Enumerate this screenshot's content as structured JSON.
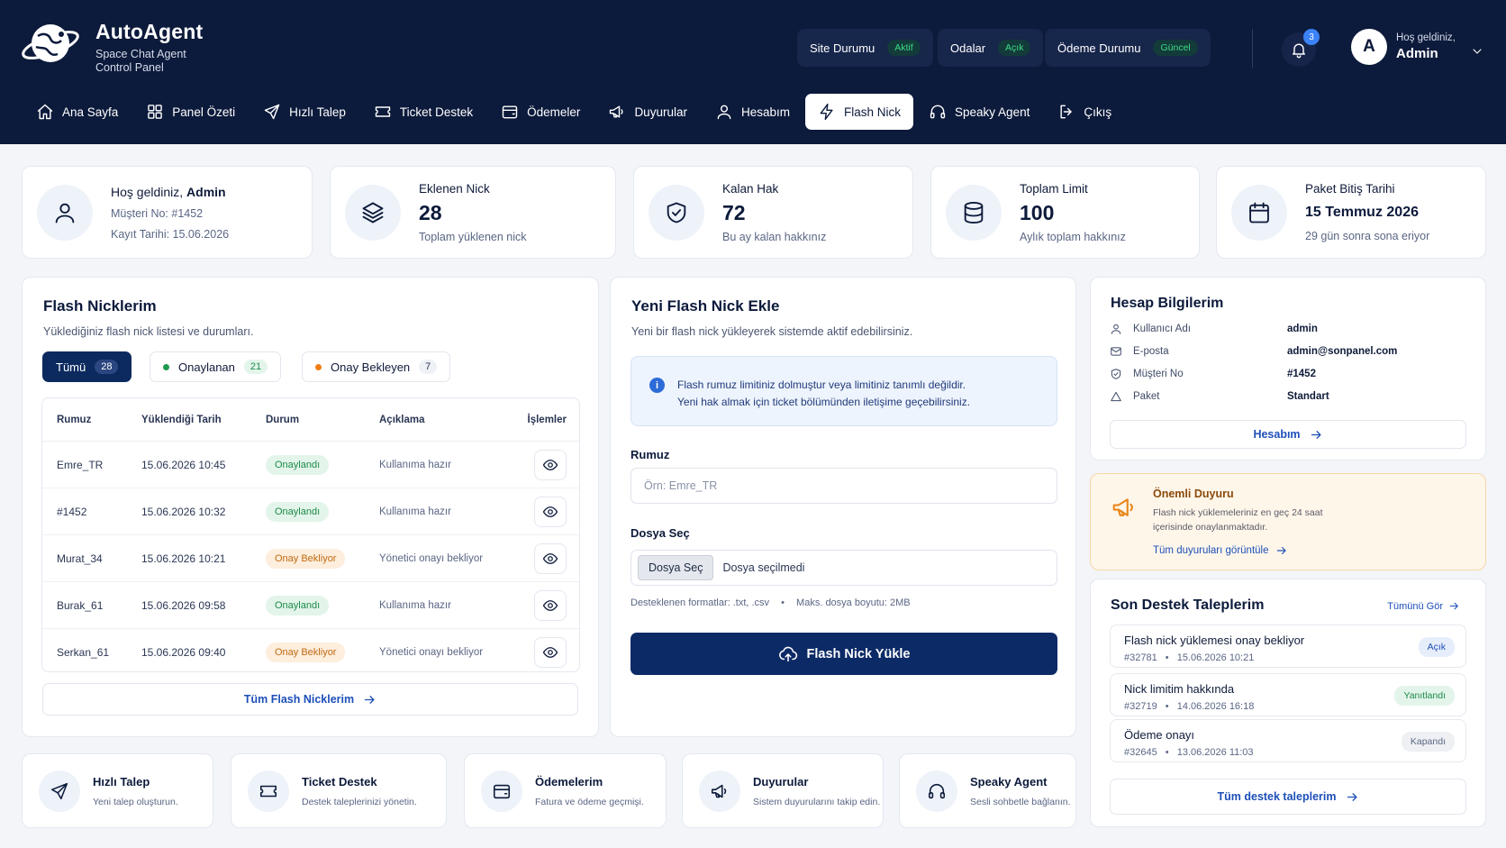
{
  "brand": {
    "name": "AutoAgent",
    "sub1": "Space Chat Agent",
    "sub2": "Control Panel"
  },
  "status": [
    {
      "label": "Site Durumu",
      "value": "Aktif"
    },
    {
      "label": "Odalar",
      "value": "Açık"
    },
    {
      "label": "Ödeme Durumu",
      "value": "Güncel"
    }
  ],
  "notifications": {
    "count": "3"
  },
  "user": {
    "initial": "A",
    "greeting": "Hoş geldiniz,",
    "name": "Admin"
  },
  "nav": [
    {
      "label": "Ana Sayfa",
      "icon": "home-icon"
    },
    {
      "label": "Panel Özeti",
      "icon": "grid-icon"
    },
    {
      "label": "Hızlı Talep",
      "icon": "send-icon"
    },
    {
      "label": "Ticket Destek",
      "icon": "ticket-icon"
    },
    {
      "label": "Ödemeler",
      "icon": "wallet-icon"
    },
    {
      "label": "Duyurular",
      "icon": "megaphone-icon"
    },
    {
      "label": "Hesabım",
      "icon": "user-icon"
    },
    {
      "label": "Flash Nick",
      "icon": "bolt-icon",
      "active": true
    },
    {
      "label": "Speaky Agent",
      "icon": "headphones-icon"
    },
    {
      "label": "Çıkış",
      "icon": "logout-icon"
    }
  ],
  "stats": {
    "welcome": {
      "prefix": "Hoş geldiniz,",
      "name": "Admin",
      "customer": "Müşteri No: #1452",
      "registered": "Kayıt Tarihi: 15.06.2026"
    },
    "added": {
      "label": "Eklenen Nick",
      "value": "28",
      "sub": "Toplam yüklenen nick"
    },
    "remaining": {
      "label": "Kalan Hak",
      "value": "72",
      "sub": "Bu ay kalan hakkınız"
    },
    "limit": {
      "label": "Toplam Limit",
      "value": "100",
      "sub": "Aylık toplam hakkınız"
    },
    "package": {
      "label": "Paket Bitiş Tarihi",
      "value": "15 Temmuz 2026",
      "sub": "29 gün sonra sona eriyor"
    }
  },
  "flash_list": {
    "title": "Flash Nicklerim",
    "subtitle": "Yüklediğiniz flash nick listesi ve durumları.",
    "tabs": [
      {
        "label": "Tümü",
        "count": "28"
      },
      {
        "label": "Onaylanan",
        "count": "21"
      },
      {
        "label": "Onay Bekleyen",
        "count": "7"
      }
    ],
    "columns": [
      "Rumuz",
      "Yüklendiği Tarih",
      "Durum",
      "Açıklama",
      "İşlemler"
    ],
    "rows": [
      {
        "nick": "Emre_TR",
        "date": "15.06.2026 10:45",
        "status": "Onaylandı",
        "note": "Kullanıma hazır"
      },
      {
        "nick": "#1452",
        "date": "15.06.2026 10:32",
        "status": "Onaylandı",
        "note": "Kullanıma hazır"
      },
      {
        "nick": "Murat_34",
        "date": "15.06.2026 10:21",
        "status": "Onay Bekliyor",
        "note": "Yönetici onayı bekliyor"
      },
      {
        "nick": "Burak_61",
        "date": "15.06.2026 09:58",
        "status": "Onaylandı",
        "note": "Kullanıma hazır"
      },
      {
        "nick": "Serkan_61",
        "date": "15.06.2026 09:40",
        "status": "Onay Bekliyor",
        "note": "Yönetici onayı bekliyor"
      }
    ],
    "all_link": "Tüm Flash Nicklerim"
  },
  "new_flash": {
    "title": "Yeni Flash Nick Ekle",
    "subtitle": "Yeni bir flash nick yükleyerek sistemde aktif edebilirsiniz.",
    "info_line1": "Flash rumuz limitiniz dolmuştur veya limitiniz tanımlı değildir.",
    "info_line2": "Yeni hak almak için ticket bölümünden iletişime geçebilirsiniz.",
    "nick_label": "Rumuz",
    "nick_placeholder": "Örn: Emre_TR",
    "file_label": "Dosya Seç",
    "file_button": "Dosya Seç",
    "file_none": "Dosya seçilmedi",
    "hint_formats": "Desteklenen formatlar: .txt, .csv",
    "hint_size": "Maks. dosya boyutu: 2MB",
    "submit": "Flash Nick Yükle"
  },
  "account": {
    "title": "Hesap Bilgilerim",
    "rows": [
      {
        "key": "Kullanıcı Adı",
        "value": "admin"
      },
      {
        "key": "E-posta",
        "value": "admin@sonpanel.com"
      },
      {
        "key": "Müşteri No",
        "value": "#1452"
      },
      {
        "key": "Paket",
        "value": "Standart"
      }
    ],
    "button": "Hesabım"
  },
  "announcement": {
    "title": "Önemli Duyuru",
    "line1": "Flash nick yüklemeleriniz en geç 24 saat",
    "line2": "içerisinde onaylanmaktadır.",
    "link": "Tüm duyuruları görüntüle"
  },
  "support": {
    "title": "Son Destek Taleplerim",
    "see_all": "Tümünü Gör",
    "items": [
      {
        "title": "Flash nick yüklemesi onay bekliyor",
        "id": "#32781",
        "date": "15.06.2026 10:21",
        "status": "Açık"
      },
      {
        "title": "Nick limitim hakkında",
        "id": "#32719",
        "date": "14.06.2026 16:18",
        "status": "Yanıtlandı"
      },
      {
        "title": "Ödeme onayı",
        "id": "#32645",
        "date": "13.06.2026 11:03",
        "status": "Kapandı"
      }
    ],
    "all_link": "Tüm destek taleplerim"
  },
  "quick": [
    {
      "title": "Hızlı Talep",
      "sub": "Yeni talep oluşturun."
    },
    {
      "title": "Ticket Destek",
      "sub": "Destek taleplerinizi yönetin."
    },
    {
      "title": "Ödemelerim",
      "sub": "Fatura ve ödeme geçmişi."
    },
    {
      "title": "Duyurular",
      "sub": "Sistem duyurularını takip edin."
    },
    {
      "title": "Speaky Agent",
      "sub": "Sesli sohbetle bağlanın."
    }
  ],
  "colors": {
    "navy": "#0c1a3b",
    "primary": "#0c2a66",
    "link": "#1d4fb8",
    "success": "#1d8a4a",
    "warning": "#c26a12"
  }
}
